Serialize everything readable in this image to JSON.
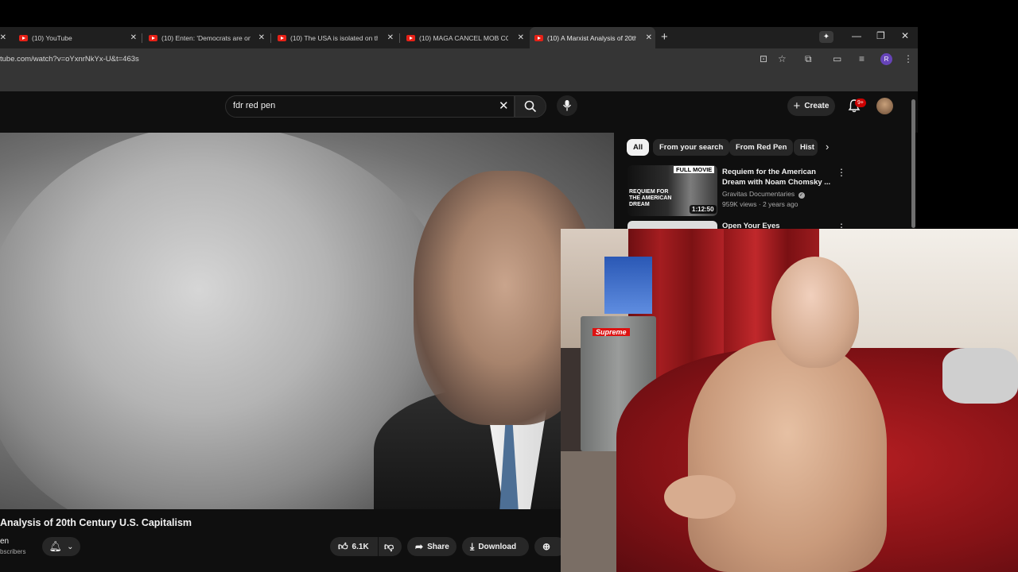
{
  "browser": {
    "tabs": [
      {
        "title": "(10) YouTube"
      },
      {
        "title": "(10) Enten: 'Democrats are on t"
      },
      {
        "title": "(10) The USA is isolated on the"
      },
      {
        "title": "(10) MAGA CANCEL MOB COM"
      },
      {
        "title": "(10) A Marxist Analysis of 20th C",
        "active": true
      }
    ],
    "url": "tube.com/watch?v=oYxnrNkYx-U&t=463s",
    "profile_initial": "R"
  },
  "youtube": {
    "search": {
      "value": "fdr red pen"
    },
    "create_label": "Create",
    "notification_badge": "9+",
    "video": {
      "title": "Analysis of 20th Century U.S. Capitalism",
      "channel": "en",
      "subscribers": "bscribers",
      "likes": "6.1K",
      "share_label": "Share",
      "download_label": "Download"
    },
    "chips": [
      "All",
      "From your search",
      "From Red Pen",
      "Hist"
    ],
    "recommendations": [
      {
        "thumb_label": "FULL MOVIE",
        "thumb_subtitle": "REQUIEM FOR THE AMERICAN DREAM",
        "duration": "1:12:50",
        "title": "Requiem for the American Dream with Noam Chomsky ...",
        "channel": "Gravitas Documentaries",
        "meta": "959K views · 2 years ago"
      },
      {
        "title": "Open Your Eyes"
      }
    ]
  },
  "webcam": {
    "sign_text": "Supreme"
  },
  "colors": {
    "yt_bg": "#0f0f0f",
    "accent_red": "#cc0000",
    "chip_bg": "#272727"
  }
}
